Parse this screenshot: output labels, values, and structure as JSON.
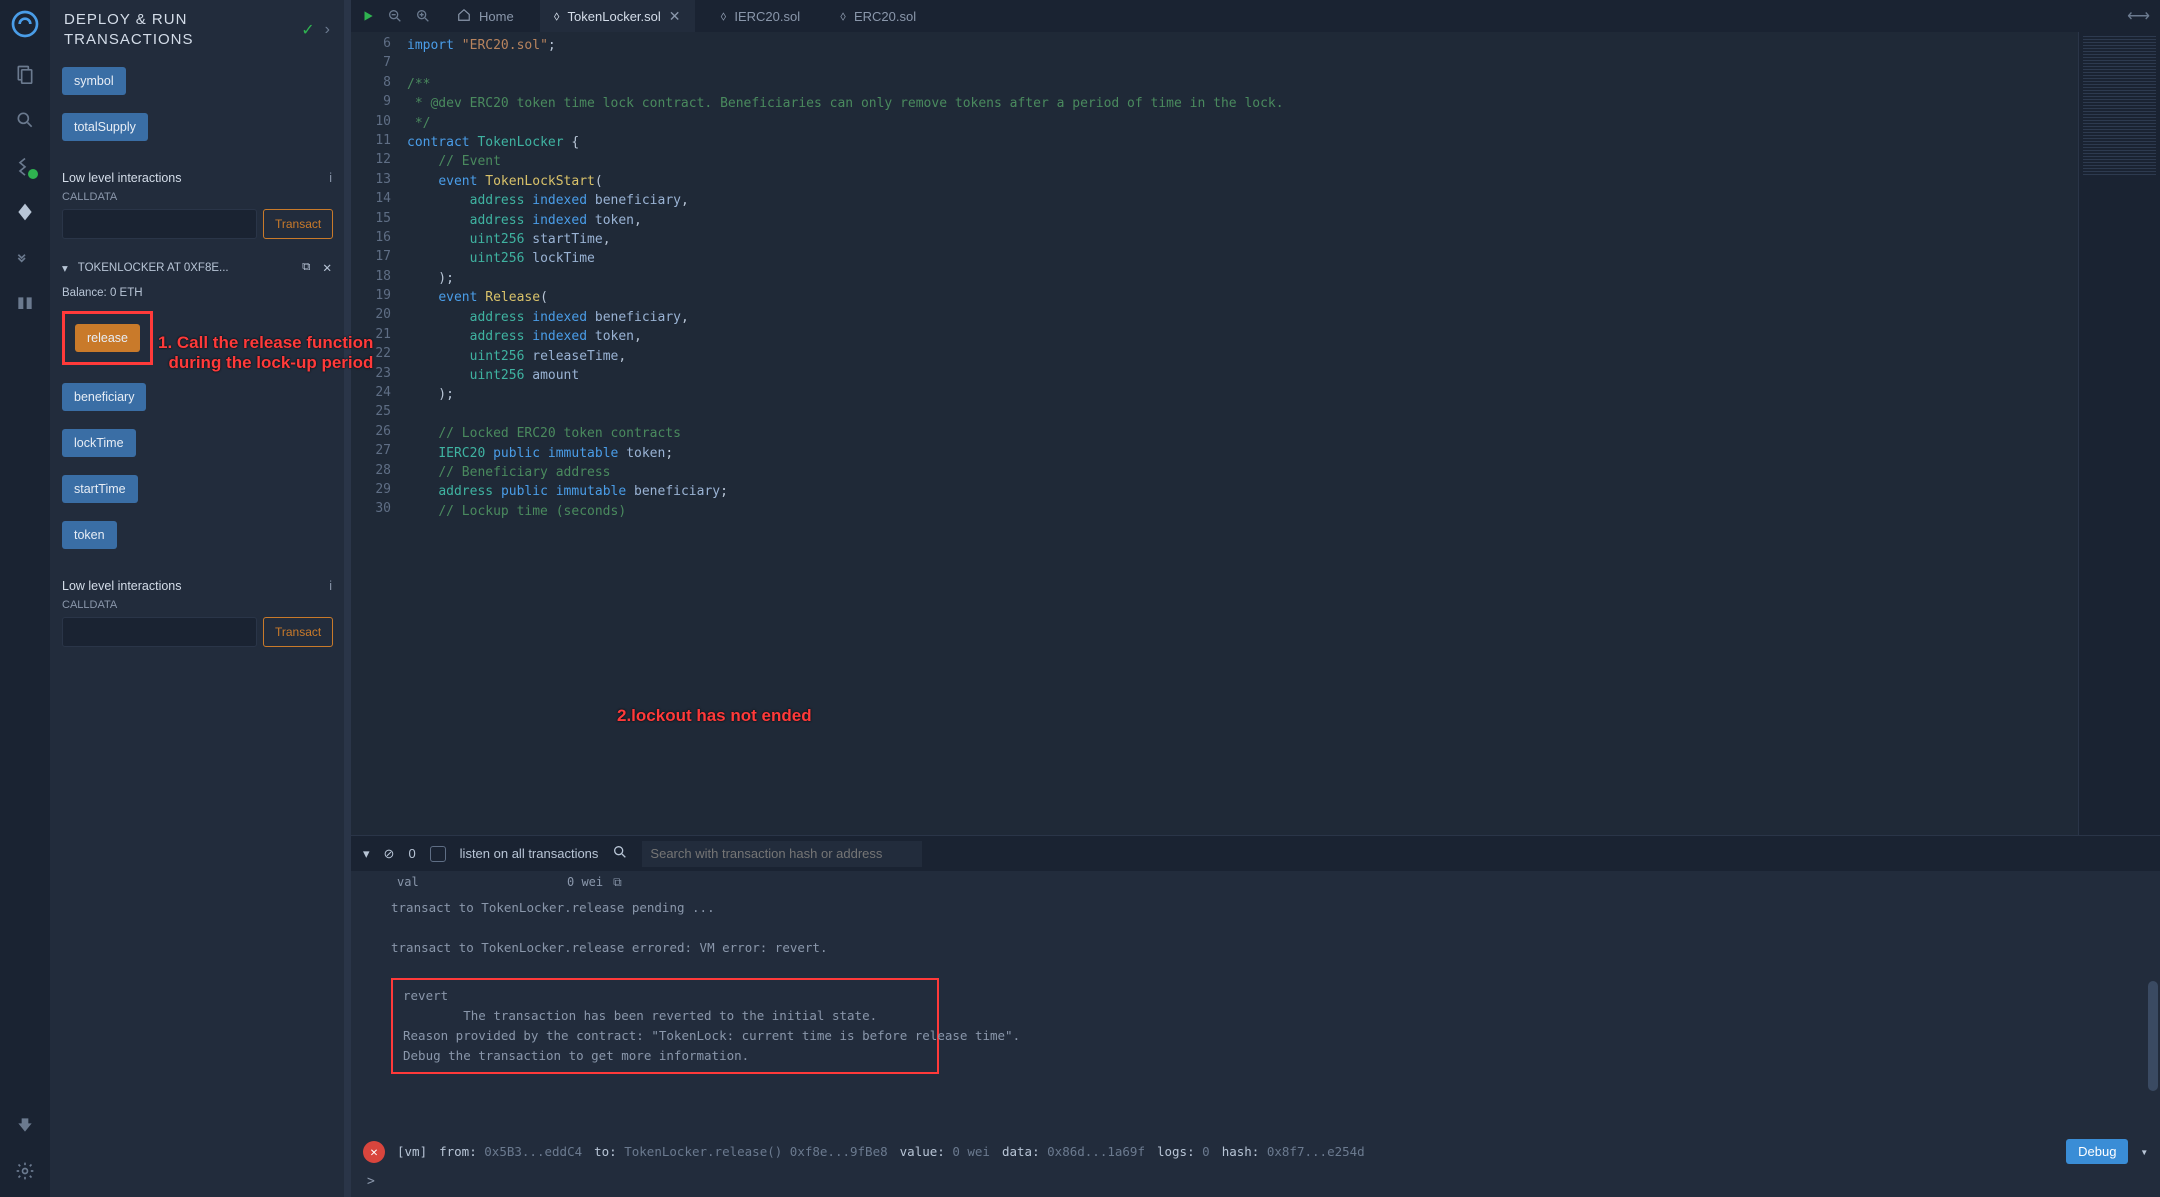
{
  "panel": {
    "title": "DEPLOY & RUN TRANSACTIONS",
    "btn_symbol": "symbol",
    "btn_totalSupply": "totalSupply",
    "low_level": "Low level interactions",
    "calldata": "CALLDATA",
    "transact": "Transact",
    "instance_label": "TOKENLOCKER AT 0XF8E...",
    "balance": "Balance: 0 ETH",
    "btn_release": "release",
    "btn_beneficiary": "beneficiary",
    "btn_lockTime": "lockTime",
    "btn_startTime": "startTime",
    "btn_token": "token"
  },
  "annotations": {
    "a1": "1. Call the release function\nduring the lock-up period",
    "a2": "2.lockout has not  ended"
  },
  "tabs": {
    "home": "Home",
    "t1": "TokenLocker.sol",
    "t2": "IERC20.sol",
    "t3": "ERC20.sol"
  },
  "editor": {
    "lines": [
      {
        "n": 6,
        "html": "<span class='kw'>import</span> <span class='str'>\"ERC20.sol\"</span>;"
      },
      {
        "n": 7,
        "html": ""
      },
      {
        "n": 8,
        "html": "<span class='cm'>/**</span>"
      },
      {
        "n": 9,
        "html": "<span class='cm'> * @dev ERC20 token time lock contract. Beneficiaries can only remove tokens after a period of time in the lock.</span>"
      },
      {
        "n": 10,
        "html": "<span class='cm'> */</span>"
      },
      {
        "n": 11,
        "html": "<span class='kw'>contract</span> <span class='ty'>TokenLocker</span> {"
      },
      {
        "n": 12,
        "html": "    <span class='cm'>// Event</span>"
      },
      {
        "n": 13,
        "html": "    <span class='kw'>event</span> <span class='fn'>TokenLockStart</span>("
      },
      {
        "n": 14,
        "html": "        <span class='ty'>address</span> <span class='kw'>indexed</span> <span class='id'>beneficiary</span>,"
      },
      {
        "n": 15,
        "html": "        <span class='ty'>address</span> <span class='kw'>indexed</span> <span class='id'>token</span>,"
      },
      {
        "n": 16,
        "html": "        <span class='ty'>uint256</span> <span class='id'>startTime</span>,"
      },
      {
        "n": 17,
        "html": "        <span class='ty'>uint256</span> <span class='id'>lockTime</span>"
      },
      {
        "n": 18,
        "html": "    );"
      },
      {
        "n": 19,
        "html": "    <span class='kw'>event</span> <span class='fn'>Release</span>("
      },
      {
        "n": 20,
        "html": "        <span class='ty'>address</span> <span class='kw'>indexed</span> <span class='id'>beneficiary</span>,"
      },
      {
        "n": 21,
        "html": "        <span class='ty'>address</span> <span class='kw'>indexed</span> <span class='id'>token</span>,"
      },
      {
        "n": 22,
        "html": "        <span class='ty'>uint256</span> <span class='id'>releaseTime</span>,"
      },
      {
        "n": 23,
        "html": "        <span class='ty'>uint256</span> <span class='id'>amount</span>"
      },
      {
        "n": 24,
        "html": "    );"
      },
      {
        "n": 25,
        "html": ""
      },
      {
        "n": 26,
        "html": "    <span class='cm'>// Locked ERC20 token contracts</span>"
      },
      {
        "n": 27,
        "html": "    <span class='ty'>IERC20</span> <span class='kw'>public</span> <span class='kw'>immutable</span> <span class='id'>token</span>;"
      },
      {
        "n": 28,
        "html": "    <span class='cm'>// Beneficiary address</span>"
      },
      {
        "n": 29,
        "html": "    <span class='ty'>address</span> <span class='kw'>public</span> <span class='kw'>immutable</span> <span class='id'>beneficiary</span>;"
      },
      {
        "n": 30,
        "html": "    <span class='cm'>// Lockup time (seconds)</span>"
      }
    ]
  },
  "terminal": {
    "count": "0",
    "listen": "listen on all transactions",
    "search_placeholder": "Search with transaction hash or address",
    "row_val": "val",
    "row_wei": "0 wei",
    "l1": "transact to TokenLocker.release pending ...",
    "l2": "transact to TokenLocker.release errored: VM error: revert.",
    "l3": "revert",
    "l4": "\tThe transaction has been reverted to the initial state.",
    "l5": "Reason provided by the contract: \"TokenLock: current time is before release time\".",
    "l6": "Debug the transaction to get more information.",
    "footer_vm": "[vm]",
    "footer_from": "from:",
    "footer_from_v": "0x5B3...eddC4",
    "footer_to": "to:",
    "footer_to_v": "TokenLocker.release() 0xf8e...9fBe8",
    "footer_value": "value:",
    "footer_value_v": "0 wei",
    "footer_data": "data:",
    "footer_data_v": "0x86d...1a69f",
    "footer_logs": "logs:",
    "footer_logs_v": "0",
    "footer_hash": "hash:",
    "footer_hash_v": "0x8f7...e254d",
    "debug": "Debug",
    "prompt": ">"
  }
}
